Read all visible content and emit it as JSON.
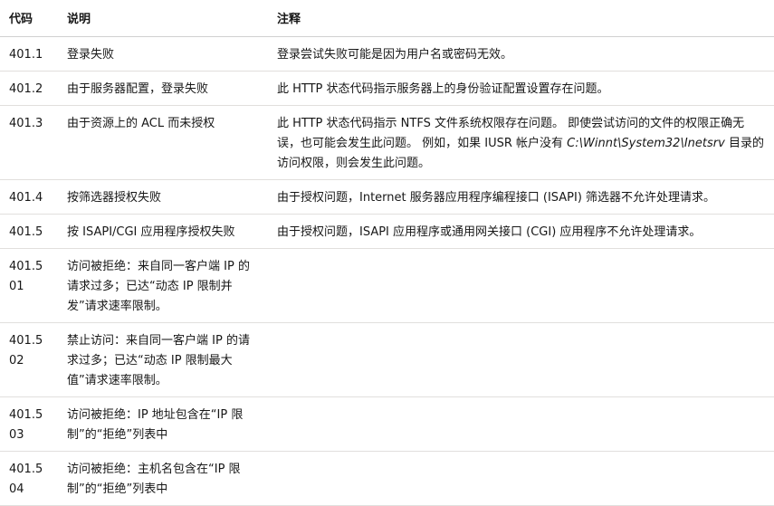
{
  "table": {
    "headers": {
      "code": "代码",
      "description": "说明",
      "notes": "注释"
    },
    "rows": [
      {
        "code": "401.1",
        "description": "登录失败",
        "notes": "登录尝试失败可能是因为用户名或密码无效。"
      },
      {
        "code": "401.2",
        "description": "由于服务器配置，登录失败",
        "notes": "此 HTTP 状态代码指示服务器上的身份验证配置设置存在问题。"
      },
      {
        "code": "401.3",
        "description": "由于资源上的 ACL 而未授权",
        "notes_before": "此 HTTP 状态代码指示 NTFS 文件系统权限存在问题。 即使尝试访问的文件的权限正确无误，也可能会发生此问题。 例如，如果 IUSR 帐户没有 ",
        "notes_path": "C:\\Winnt\\System32\\Inetsrv",
        "notes_after": " 目录的访问权限，则会发生此问题。"
      },
      {
        "code": "401.4",
        "description": "按筛选器授权失败",
        "notes": "由于授权问题，Internet 服务器应用程序编程接口 (ISAPI) 筛选器不允许处理请求。"
      },
      {
        "code": "401.5",
        "description": "按 ISAPI/CGI 应用程序授权失败",
        "notes": "由于授权问题，ISAPI 应用程序或通用网关接口 (CGI) 应用程序不允许处理请求。"
      },
      {
        "code": "401.501",
        "description": "访问被拒绝：来自同一客户端 IP 的请求过多；已达“动态 IP 限制并发”请求速率限制。",
        "notes": ""
      },
      {
        "code": "401.502",
        "description": "禁止访问：来自同一客户端 IP 的请求过多；已达“动态 IP 限制最大值”请求速率限制。",
        "notes": ""
      },
      {
        "code": "401.503",
        "description": "访问被拒绝：IP 地址包含在“IP 限制”的“拒绝”列表中",
        "notes": ""
      },
      {
        "code": "401.504",
        "description": "访问被拒绝：主机名包含在“IP 限制”的“拒绝”列表中",
        "notes": ""
      }
    ]
  }
}
